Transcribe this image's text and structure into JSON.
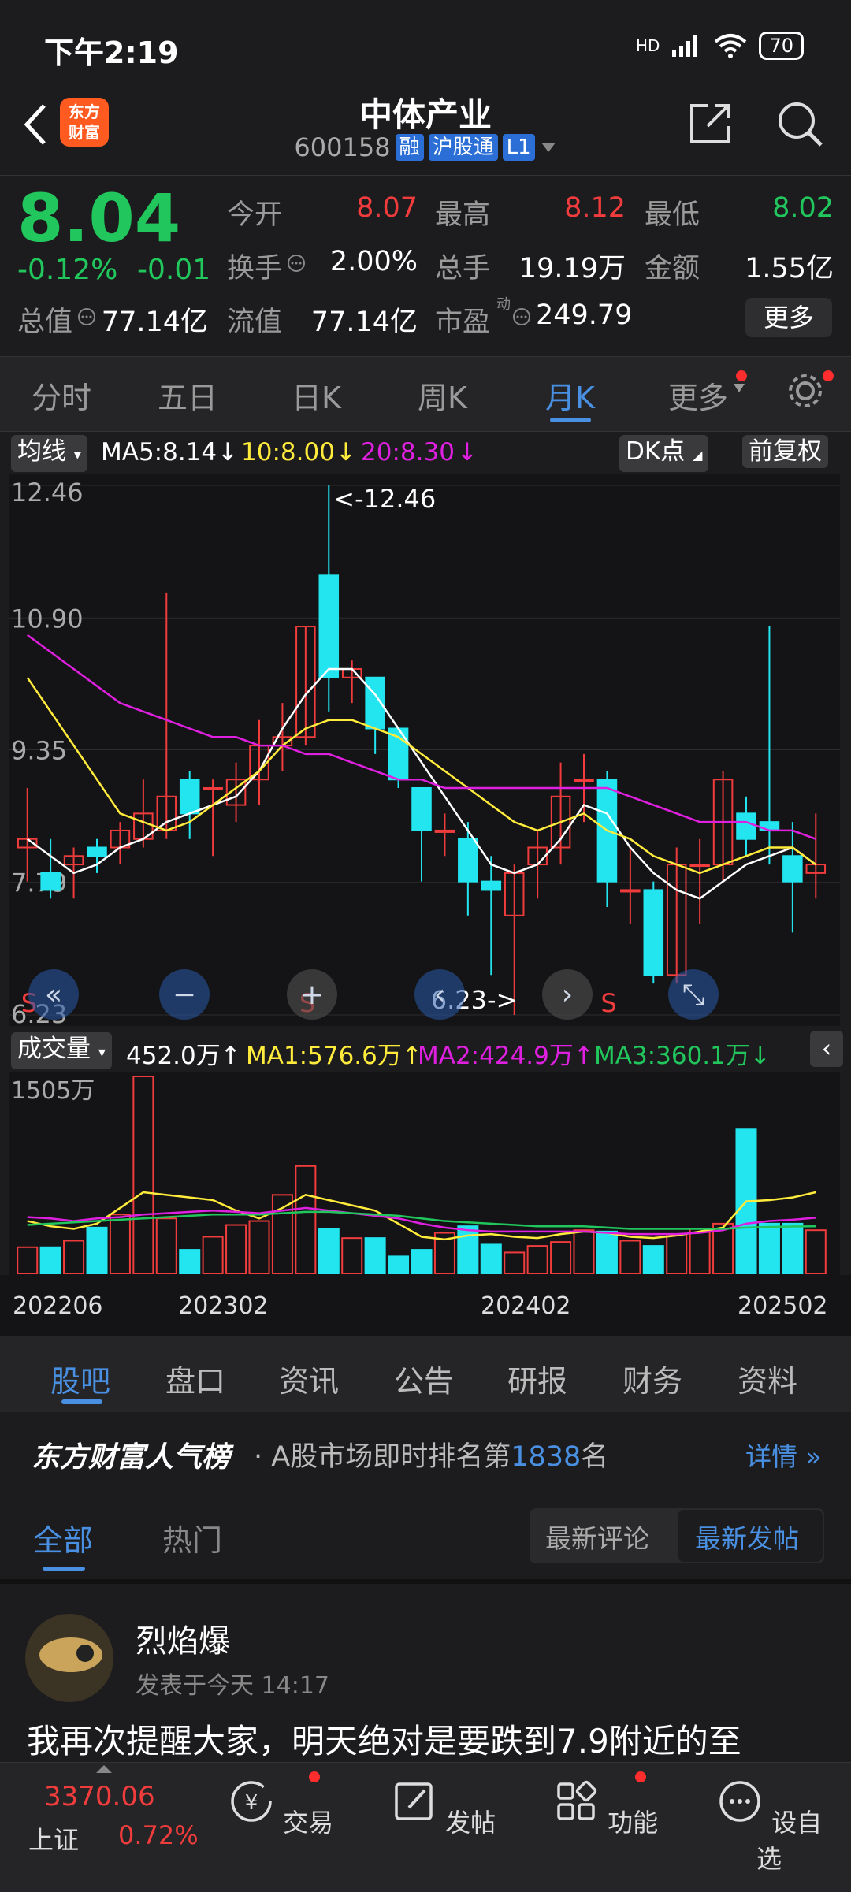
{
  "status_bar": {
    "time": "下午2:19",
    "battery": "70",
    "network": "HD"
  },
  "header": {
    "stock_name": "中体产业",
    "stock_code": "600158",
    "tags": [
      "融",
      "沪股通",
      "L1"
    ],
    "logo_text": "东方财富"
  },
  "quote": {
    "price": "8.04",
    "change_pct": "-0.12%",
    "change_abs": "-0.01",
    "rows": [
      [
        {
          "label": "今开",
          "value": "8.07",
          "color": "red"
        },
        {
          "label": "最高",
          "value": "8.12",
          "color": "red"
        },
        {
          "label": "最低",
          "value": "8.02",
          "color": "green"
        }
      ],
      [
        {
          "label": "换手",
          "value": "2.00%",
          "color": "white"
        },
        {
          "label": "总手",
          "value": "19.19万",
          "color": "white"
        },
        {
          "label": "金额",
          "value": "1.55亿",
          "color": "white"
        }
      ],
      [
        {
          "label": "总值",
          "value": "77.14亿",
          "color": "white"
        },
        {
          "label": "流值",
          "value": "77.14亿",
          "color": "white"
        },
        {
          "label": "市盈",
          "value": "249.79",
          "color": "white",
          "sup": "动"
        }
      ]
    ],
    "more_label": "更多"
  },
  "period_tabs": [
    "分时",
    "五日",
    "日K",
    "周K",
    "月K",
    "更多"
  ],
  "active_period": "月K",
  "indicators": {
    "ma_selector": "均线",
    "ma5": "MA5:8.14",
    "ma10": "10:8.00",
    "ma20": "20:8.30",
    "dk_button": "DK点",
    "adjust_button": "前复权"
  },
  "chart_data": {
    "type": "candlestick",
    "y_ticks": [
      "12.46",
      "10.90",
      "9.35",
      "7.79",
      "6.23"
    ],
    "ylim": [
      6.23,
      12.46
    ],
    "high_marker": "<-12.46",
    "low_marker": "6.23->",
    "x_ticks": [
      "202206",
      "202302",
      "202402",
      "202502"
    ],
    "candles": [
      {
        "o": 8.2,
        "c": 8.3,
        "h": 8.9,
        "l": 7.8
      },
      {
        "o": 7.9,
        "c": 7.7,
        "h": 8.3,
        "l": 7.6
      },
      {
        "o": 8.0,
        "c": 8.1,
        "h": 8.2,
        "l": 7.6
      },
      {
        "o": 8.2,
        "c": 8.1,
        "h": 8.3,
        "l": 7.9
      },
      {
        "o": 8.2,
        "c": 8.4,
        "h": 8.5,
        "l": 8.0
      },
      {
        "o": 8.3,
        "c": 8.6,
        "h": 9.0,
        "l": 8.2
      },
      {
        "o": 8.4,
        "c": 8.8,
        "h": 11.2,
        "l": 8.3
      },
      {
        "o": 9.0,
        "c": 8.6,
        "h": 9.1,
        "l": 8.3
      },
      {
        "o": 8.9,
        "c": 8.9,
        "h": 9.0,
        "l": 8.1
      },
      {
        "o": 8.7,
        "c": 9.0,
        "h": 9.2,
        "l": 8.5
      },
      {
        "o": 9.0,
        "c": 9.4,
        "h": 9.7,
        "l": 8.7
      },
      {
        "o": 9.4,
        "c": 9.5,
        "h": 9.9,
        "l": 9.1
      },
      {
        "o": 9.5,
        "c": 10.8,
        "h": 10.8,
        "l": 9.4
      },
      {
        "o": 11.4,
        "c": 10.2,
        "h": 12.46,
        "l": 9.8
      },
      {
        "o": 10.2,
        "c": 10.3,
        "h": 10.4,
        "l": 9.9
      },
      {
        "o": 10.2,
        "c": 9.6,
        "h": 10.2,
        "l": 9.3
      },
      {
        "o": 9.6,
        "c": 9.0,
        "h": 9.6,
        "l": 8.9
      },
      {
        "o": 8.9,
        "c": 8.4,
        "h": 8.9,
        "l": 7.8
      },
      {
        "o": 8.4,
        "c": 8.4,
        "h": 8.6,
        "l": 8.1
      },
      {
        "o": 8.3,
        "c": 7.8,
        "h": 8.5,
        "l": 7.4
      },
      {
        "o": 7.8,
        "c": 7.7,
        "h": 8.1,
        "l": 6.7
      },
      {
        "o": 7.4,
        "c": 7.9,
        "h": 8.0,
        "l": 6.23
      },
      {
        "o": 8.0,
        "c": 8.2,
        "h": 8.4,
        "l": 7.6
      },
      {
        "o": 8.2,
        "c": 8.8,
        "h": 9.2,
        "l": 8.0
      },
      {
        "o": 9.0,
        "c": 9.0,
        "h": 9.3,
        "l": 8.5
      },
      {
        "o": 9.0,
        "c": 7.8,
        "h": 9.1,
        "l": 7.5
      },
      {
        "o": 7.7,
        "c": 7.7,
        "h": 8.2,
        "l": 7.3
      },
      {
        "o": 7.7,
        "c": 6.7,
        "h": 7.8,
        "l": 6.6
      },
      {
        "o": 6.7,
        "c": 8.0,
        "h": 8.2,
        "l": 6.6
      },
      {
        "o": 8.0,
        "c": 8.0,
        "h": 8.3,
        "l": 7.3
      },
      {
        "o": 8.0,
        "c": 9.0,
        "h": 9.1,
        "l": 7.8
      },
      {
        "o": 8.6,
        "c": 8.3,
        "h": 8.8,
        "l": 8.1
      },
      {
        "o": 8.5,
        "c": 8.4,
        "h": 10.8,
        "l": 8.0
      },
      {
        "o": 8.1,
        "c": 7.8,
        "h": 8.5,
        "l": 7.2
      },
      {
        "o": 7.9,
        "c": 8.0,
        "h": 8.6,
        "l": 7.6
      }
    ],
    "ma_lines": {
      "ma5": {
        "color": "#ffffff",
        "values": [
          8.3,
          8.1,
          7.9,
          8.0,
          8.2,
          8.3,
          8.5,
          8.6,
          8.7,
          8.8,
          9.1,
          9.6,
          10.0,
          10.3,
          10.3,
          10.0,
          9.6,
          9.2,
          8.8,
          8.4,
          8.0,
          7.9,
          8.0,
          8.3,
          8.7,
          8.6,
          8.2,
          7.9,
          7.7,
          7.6,
          7.8,
          8.0,
          8.1,
          8.2,
          8.0
        ]
      },
      "ma10": {
        "color": "#ffeb3b",
        "values": [
          10.2,
          9.8,
          9.4,
          9.0,
          8.6,
          8.5,
          8.4,
          8.5,
          8.7,
          8.9,
          9.1,
          9.4,
          9.6,
          9.7,
          9.7,
          9.6,
          9.5,
          9.3,
          9.1,
          8.9,
          8.7,
          8.5,
          8.4,
          8.5,
          8.6,
          8.4,
          8.3,
          8.1,
          8.0,
          7.9,
          8.0,
          8.1,
          8.2,
          8.2,
          8.0
        ]
      },
      "ma20": {
        "color": "#e020e0",
        "values": [
          10.7,
          10.5,
          10.3,
          10.1,
          9.9,
          9.8,
          9.7,
          9.6,
          9.5,
          9.5,
          9.4,
          9.4,
          9.3,
          9.3,
          9.2,
          9.1,
          9.0,
          9.0,
          8.9,
          8.9,
          8.9,
          8.9,
          8.9,
          8.9,
          8.9,
          8.9,
          8.8,
          8.7,
          8.6,
          8.5,
          8.5,
          8.5,
          8.4,
          8.4,
          8.3
        ]
      }
    },
    "sell_markers": [
      "S",
      "S",
      "S"
    ]
  },
  "volume": {
    "selector": "成交量",
    "current": "452.0万",
    "ma1": "MA1:576.6万",
    "ma2": "MA2:424.9万",
    "ma3": "MA3:360.1万",
    "max_label": "1505万",
    "bars": [
      200,
      200,
      250,
      350,
      450,
      1505,
      420,
      180,
      280,
      370,
      400,
      600,
      820,
      340,
      270,
      270,
      130,
      180,
      310,
      360,
      220,
      160,
      210,
      240,
      330,
      320,
      250,
      210,
      300,
      340,
      380,
      1100,
      380,
      380,
      330
    ],
    "ma1_line": [
      400,
      360,
      340,
      380,
      500,
      620,
      600,
      580,
      560,
      480,
      420,
      500,
      600,
      560,
      520,
      480,
      380,
      280,
      260,
      290,
      300,
      280,
      270,
      300,
      320,
      310,
      280,
      270,
      290,
      320,
      350,
      550,
      560,
      580,
      620
    ],
    "ma2_line": [
      430,
      420,
      400,
      420,
      430,
      450,
      460,
      470,
      480,
      470,
      460,
      480,
      500,
      480,
      460,
      440,
      420,
      380,
      350,
      330,
      320,
      320,
      320,
      320,
      320,
      310,
      300,
      300,
      300,
      310,
      330,
      380,
      400,
      410,
      425
    ],
    "ma3_line": [
      370,
      380,
      390,
      400,
      410,
      420,
      430,
      440,
      450,
      450,
      450,
      460,
      470,
      470,
      460,
      450,
      440,
      420,
      400,
      390,
      380,
      370,
      360,
      360,
      360,
      350,
      340,
      340,
      340,
      340,
      340,
      350,
      355,
      358,
      360
    ]
  },
  "section_tabs": [
    "股吧",
    "盘口",
    "资讯",
    "公告",
    "研报",
    "财务",
    "资料"
  ],
  "ranking": {
    "brand": "东方财富人气榜",
    "text_prefix": "· A股市场即时排名第",
    "rank": "1838",
    "text_suffix": "名",
    "details": "详情"
  },
  "filters": {
    "tabs": [
      "全部",
      "热门"
    ],
    "sort": [
      "最新评论",
      "最新发帖"
    ]
  },
  "post": {
    "author": "烈焰爆",
    "time": "发表于今天 14:17",
    "content": "我再次提醒大家，明天绝对是要跌到7.9附近的至"
  },
  "bottom_nav": {
    "index_value": "3370.06",
    "index_name": "上证",
    "index_change": "0.72%",
    "items": [
      "交易",
      "发帖",
      "功能",
      "设自选"
    ]
  }
}
